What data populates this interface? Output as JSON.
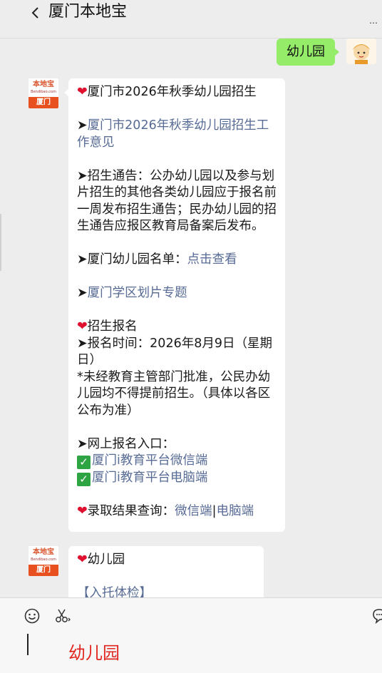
{
  "header": {
    "title": "厦门本地宝",
    "more": "…"
  },
  "outgoing": {
    "text": "幼儿园"
  },
  "bot": {
    "avatar_top": "本地宝",
    "avatar_sub": "Bendibao.com",
    "avatar_city": "厦门"
  },
  "message1": {
    "heading": "厦门市2026年秋季幼儿园招生",
    "arrow": "➤",
    "link_opinion": "厦门市2026年秋季幼儿园招生工作意见",
    "notice": "招生通告：公办幼儿园以及参与划片招生的其他各类幼儿园应于报名前一周发布招生通告；民办幼儿园的招生通告应报区教育局备案后发布。",
    "list_label": "厦门幼儿园名单：",
    "list_link": "点击查看",
    "district_link": "厦门学区划片专题",
    "register_heading": "招生报名",
    "register_time": "报名时间：2026年8月9日（星期日）",
    "note": "*未经教育主管部门批准，公民办幼儿园均不得提前招生。（具体以各区公布为准）",
    "online_label": "网上报名入口：",
    "wechat_entry": "厦门i教育平台微信端",
    "pc_entry": "厦门i教育平台电脑端",
    "result_label": "录取结果查询：",
    "result_wechat": "微信端",
    "divider": "|",
    "result_pc": "电脑端"
  },
  "message2": {
    "heading": "幼儿园",
    "partial": "【入托体检】"
  },
  "input": {
    "draft": "幼儿园"
  }
}
